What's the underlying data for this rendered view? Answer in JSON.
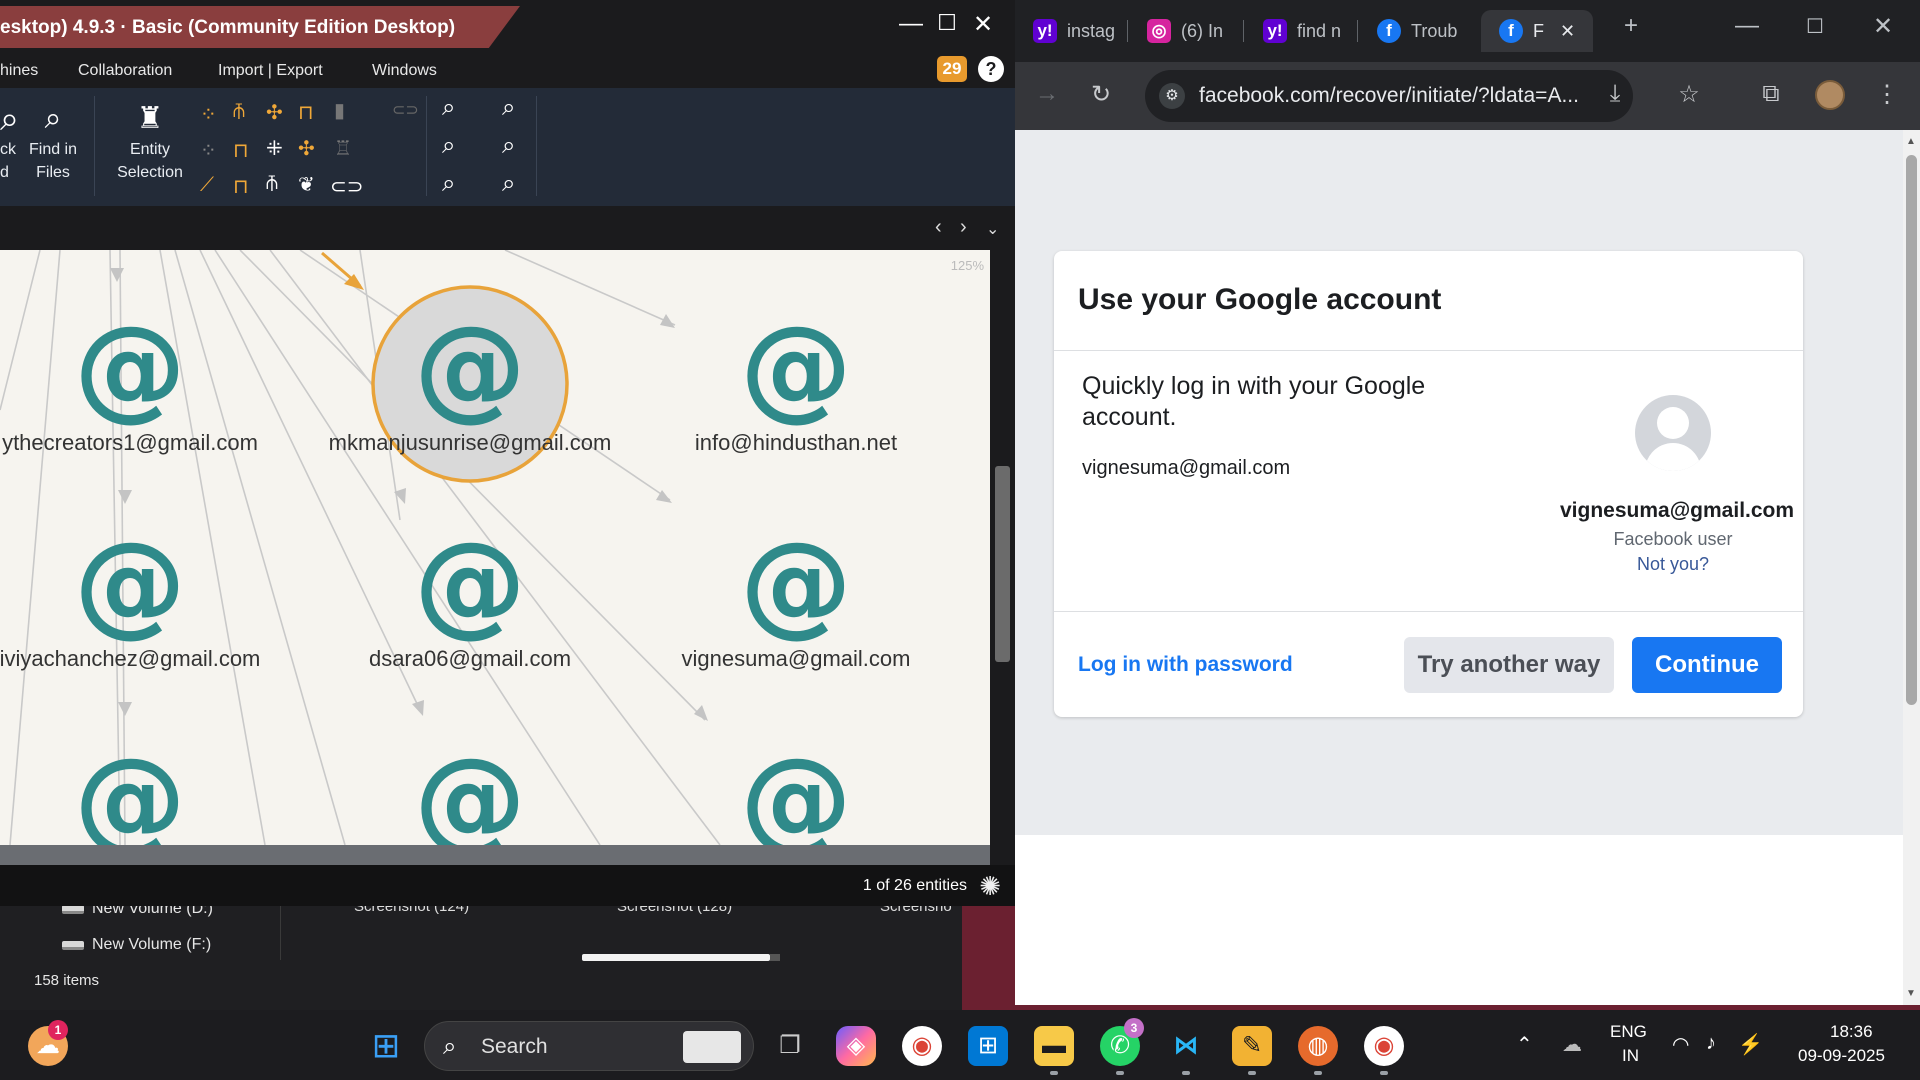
{
  "explorer": {
    "drives": [
      "New Volume (D:)",
      "New Volume (F:)"
    ],
    "thumbnails": [
      "Screenshot (124)",
      "Screenshot (128)",
      "Screensho"
    ],
    "items_count": "158 items"
  },
  "maltego": {
    "title": "esktop) 4.9.3 · Basic (Community Edition Desktop)",
    "menu": [
      "hines",
      "Collaboration",
      "Import | Export",
      "Windows"
    ],
    "notification_count": "29",
    "ribbon": {
      "btn_partial_1": "ck",
      "btn_partial_2": "d",
      "find_in_files_1": "Find in",
      "find_in_files_2": "Files",
      "entity_selection_1": "Entity",
      "entity_selection_2": "Selection"
    },
    "zoom_level": "125%",
    "nodes": [
      {
        "label": "ythecreators1@gmail.com"
      },
      {
        "label": "mkmanjusunrise@gmail.com"
      },
      {
        "label": "info@hindusthan.net"
      },
      {
        "label": "iviyachanchez@gmail.com"
      },
      {
        "label": "dsara06@gmail.com"
      },
      {
        "label": "vignesuma@gmail.com"
      },
      {
        "label": ""
      },
      {
        "label": ""
      },
      {
        "label": ""
      }
    ],
    "node_glyph": "@",
    "entity_count": "1 of 26 entities"
  },
  "chrome": {
    "tabs": [
      {
        "label": "instag",
        "icon": "yahoo-icon"
      },
      {
        "label": "(6) In",
        "icon": "instagram-icon"
      },
      {
        "label": "find n",
        "icon": "yahoo-icon"
      },
      {
        "label": "Troub",
        "icon": "facebook-icon"
      },
      {
        "label": "F",
        "icon": "facebook-icon"
      }
    ],
    "url": "facebook.com/recover/initiate/?ldata=A..."
  },
  "facebook": {
    "card_title": "Use your Google account",
    "description": "Quickly log in with your Google account.",
    "email": "vignesuma@gmail.com",
    "profile_email": "vignesuma@gmail.com",
    "profile_sub": "Facebook user",
    "not_you": "Not you?",
    "login_with_password": "Log in with password",
    "try_another_way": "Try another way",
    "continue": "Continue"
  },
  "taskbar": {
    "search_placeholder": "Search",
    "weather_badge": "1",
    "whatsapp_badge": "3",
    "language_1": "ENG",
    "language_2": "IN",
    "time": "18:36",
    "date": "09-09-2025"
  },
  "colors": {
    "maltego_title_tab": "#8a3e3e",
    "maltego_accent": "#f0a838",
    "node_teal": "#2f8a8a",
    "facebook_blue": "#1877f2",
    "selection_ring": "#e8a33a"
  }
}
